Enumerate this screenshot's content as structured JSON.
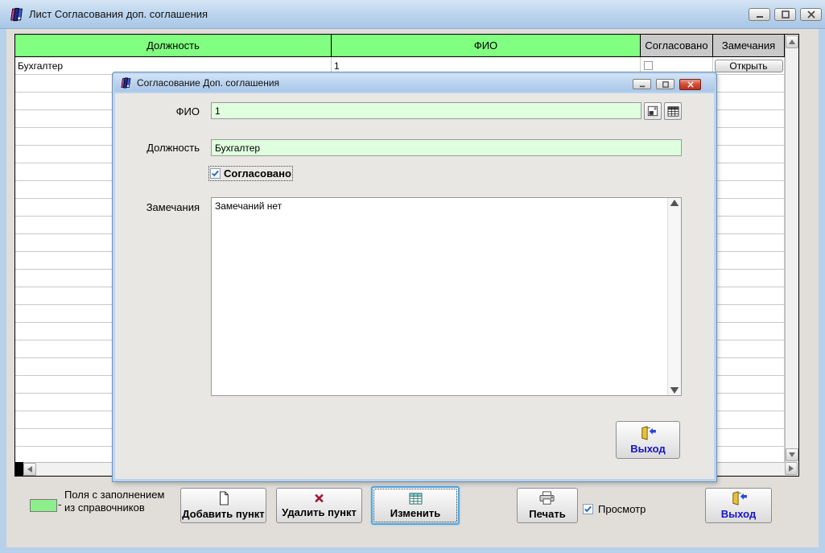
{
  "main_window": {
    "title": "Лист Согласования доп. соглашения",
    "table": {
      "headers": [
        "Должность",
        "ФИО",
        "Согласовано",
        "Замечания"
      ],
      "row": {
        "position": "Бухгалтер",
        "fio": "1",
        "agreed": false,
        "open_button": "Открыть"
      },
      "empty_row_count": 22
    },
    "legend": {
      "dash": "-",
      "line1": "Поля с заполнением",
      "line2": "из справочников"
    },
    "toolbar": {
      "add_label": "Добавить пункт",
      "delete_label": "Удалить пункт",
      "edit_label": "Изменить",
      "print_label": "Печать",
      "preview_label": "Просмотр",
      "preview_checked": true,
      "exit_label": "Выход"
    }
  },
  "dialog": {
    "title": "Согласование Доп. соглашения",
    "fio_label": "ФИО",
    "fio_value": "1",
    "position_label": "Должность",
    "position_value": "Бухгалтер",
    "agreed_label": "Согласовано",
    "agreed_checked": true,
    "remarks_label": "Замечания",
    "remarks_value": "Замечаний нет",
    "exit_label": "Выход"
  },
  "colors": {
    "header_green": "#80ff80",
    "field_green": "#dfffdf",
    "header_gray": "#c9c9c9",
    "titlebar_blue": "#bcd4ee",
    "link_blue": "#1414cc",
    "close_red": "#bc2f1e"
  }
}
